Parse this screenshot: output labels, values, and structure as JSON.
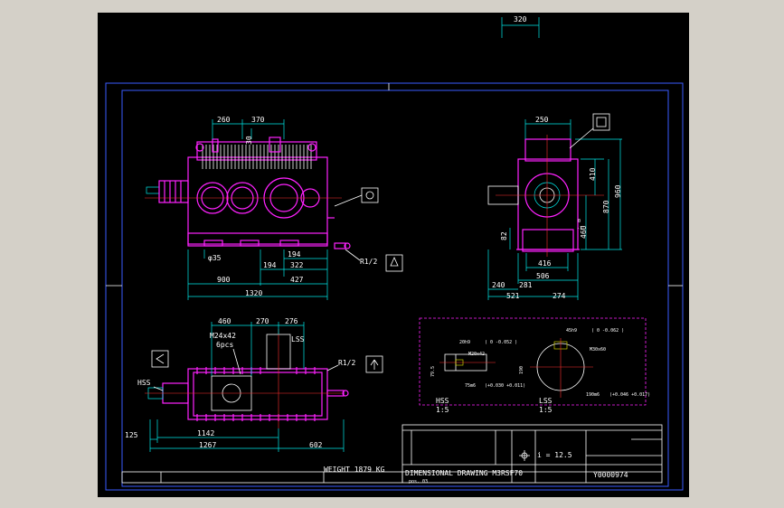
{
  "colors": {
    "background": "#d4d0c8",
    "canvas": "#000000",
    "geometry": "#ff22ff",
    "dimension": "#00e8e8",
    "border": "#3a5bff",
    "text": "#ffffff"
  },
  "front_view": {
    "dim_260": "260",
    "dim_370": "370",
    "dim_30": "30",
    "dim_phi35": "φ35",
    "dim_194a": "194",
    "dim_194b": "194",
    "dim_322": "322",
    "dim_900": "900",
    "dim_427": "427",
    "dim_1320": "1320",
    "plug_label": "R1/2"
  },
  "side_view": {
    "dim_320": "320",
    "dim_250": "250",
    "dim_410": "410",
    "dim_870": "870",
    "dim_960": "960",
    "dim_460": "460",
    "tol_top": "0",
    "tol_bot": "-1",
    "dim_82": "82",
    "dim_416": "416",
    "dim_506": "506",
    "dim_240": "240",
    "dim_281": "281",
    "dim_521": "521",
    "dim_274": "274"
  },
  "top_view": {
    "dim_460": "460",
    "dim_270": "270",
    "dim_276": "276",
    "bolt_label": "M24x42",
    "bolt_count": "6pcs",
    "lss_label": "LSS",
    "hss_label": "HSS",
    "plug_label": "R1/2",
    "dim_125": "125",
    "dim_1142": "1142",
    "dim_1267": "1267",
    "dim_602": "602",
    "weight": "WEIGHT 1879 KG"
  },
  "shaft_detail": {
    "hss_fit": "20h9",
    "hss_fit_tol": "( 0 -0.052 )",
    "hss_thread": "M20x42",
    "hss_dim_79": "79.5",
    "hss_dia": "75m6",
    "hss_dia_tol": "(+0.030 +0.011)",
    "lss_fit": "45h9",
    "lss_fit_tol": "( 0 -0.062 )",
    "lss_thread": "M30x60",
    "lss_dim_190": "190",
    "lss_dia": "190m6",
    "lss_dia_tol": "(+0.046 +0.017)",
    "hss_label": "HSS",
    "hss_scale": "1:5",
    "lss_label": "LSS",
    "lss_scale": "1:5"
  },
  "title_block": {
    "ratio_label": "i = 12.5",
    "title_line": "DIMENSIONAL DRAWING M3RSF70",
    "pos_line": "pos. 03",
    "doc_number": "Y0000974"
  }
}
